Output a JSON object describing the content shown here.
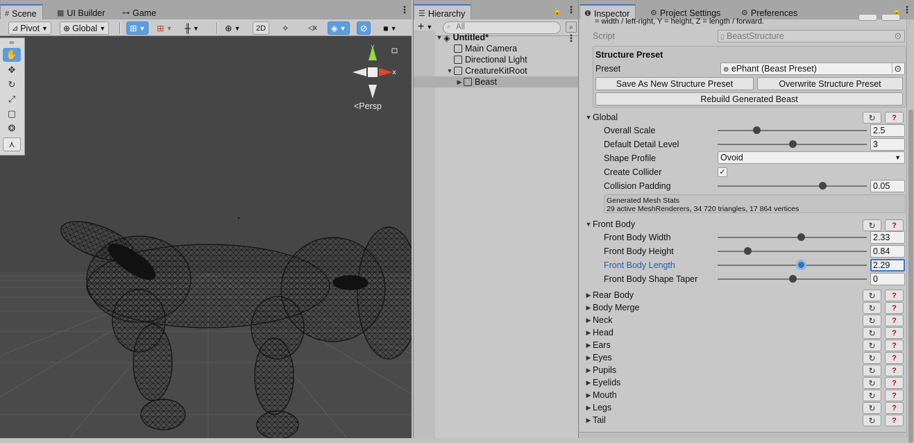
{
  "scene": {
    "tabs": [
      {
        "label": "Scene",
        "icon": "grid-icon"
      },
      {
        "label": "UI Builder",
        "icon": "layout-icon"
      },
      {
        "label": "Game",
        "icon": "gamepad-icon"
      }
    ],
    "toolbar": {
      "pivot": "Pivot",
      "global": "Global",
      "two_d": "2D"
    },
    "persp_label": "<Persp",
    "accent": "#5a9ee0"
  },
  "hierarchy": {
    "tab": "Hierarchy",
    "search_placeholder": "All",
    "add_label": "+",
    "items": [
      {
        "label": "Untitled*"
      },
      {
        "label": "Main Camera"
      },
      {
        "label": "Directional Light"
      },
      {
        "label": "CreatureKitRoot"
      },
      {
        "label": "Beast"
      }
    ]
  },
  "inspector": {
    "tabs": [
      {
        "label": "Inspector",
        "icon": "info-icon"
      },
      {
        "label": "Project Settings",
        "icon": "gear-icon"
      },
      {
        "label": "Preferences",
        "icon": "gear-icon"
      }
    ],
    "note": "= width / left-right, Y = height, Z = length / forward.",
    "script_label": "Script",
    "script_value": "BeastStructure",
    "preset_section": "Structure Preset",
    "preset_label": "Preset",
    "preset_value": "ePhant (Beast Preset)",
    "save_preset": "Save As New Structure Preset",
    "overwrite_preset": "Overwrite Structure Preset",
    "rebuild": "Rebuild Generated Beast",
    "global": {
      "title": "Global",
      "overall_scale": {
        "label": "Overall Scale",
        "value": "2.5",
        "fraction": 0.26
      },
      "detail_level": {
        "label": "Default Detail Level",
        "value": "3",
        "fraction": 0.5
      },
      "shape_profile": {
        "label": "Shape Profile",
        "value": "Ovoid"
      },
      "create_collider": {
        "label": "Create Collider",
        "checked": true
      },
      "collision_padding": {
        "label": "Collision Padding",
        "value": "0.05",
        "fraction": 0.7
      }
    },
    "mesh_stats_title": "Generated Mesh Stats",
    "mesh_stats_text": "29 active MeshRenderers, 34 720 triangles, 17 864 vertices",
    "front_body": {
      "title": "Front Body",
      "width": {
        "label": "Front Body Width",
        "value": "2.33",
        "fraction": 0.56
      },
      "height": {
        "label": "Front Body Height",
        "value": "0.84",
        "fraction": 0.2
      },
      "length": {
        "label": "Front Body Length",
        "value": "2.29",
        "fraction": 0.56
      },
      "taper": {
        "label": "Front Body Shape Taper",
        "value": "0",
        "fraction": 0.5
      }
    },
    "sections": [
      "Rear Body",
      "Body Merge",
      "Neck",
      "Head",
      "Ears",
      "Eyes",
      "Pupils",
      "Eyelids",
      "Mouth",
      "Legs",
      "Tail"
    ],
    "reset_glyph": "↻",
    "help_glyph": "?"
  }
}
